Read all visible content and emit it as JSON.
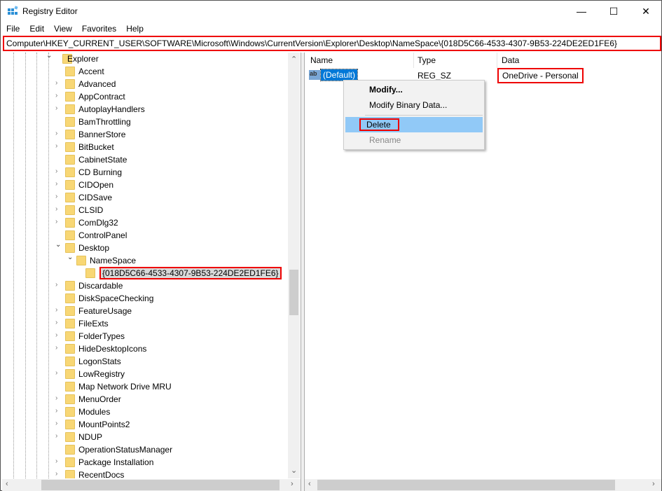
{
  "window": {
    "title": "Registry Editor",
    "controls": {
      "minimize": "—",
      "maximize": "☐",
      "close": "✕"
    }
  },
  "menu": [
    "File",
    "Edit",
    "View",
    "Favorites",
    "Help"
  ],
  "address": "Computer\\HKEY_CURRENT_USER\\SOFTWARE\\Microsoft\\Windows\\CurrentVersion\\Explorer\\Desktop\\NameSpace\\{018D5C66-4533-4307-9B53-224DE2ED1FE6}",
  "tree": [
    {
      "label": "Explorer",
      "level": 0,
      "state": "expanded"
    },
    {
      "label": "Accent",
      "level": 1,
      "state": "leaf"
    },
    {
      "label": "Advanced",
      "level": 1,
      "state": "collapsed"
    },
    {
      "label": "AppContract",
      "level": 1,
      "state": "collapsed"
    },
    {
      "label": "AutoplayHandlers",
      "level": 1,
      "state": "collapsed"
    },
    {
      "label": "BamThrottling",
      "level": 1,
      "state": "leaf"
    },
    {
      "label": "BannerStore",
      "level": 1,
      "state": "collapsed"
    },
    {
      "label": "BitBucket",
      "level": 1,
      "state": "collapsed"
    },
    {
      "label": "CabinetState",
      "level": 1,
      "state": "leaf"
    },
    {
      "label": "CD Burning",
      "level": 1,
      "state": "collapsed"
    },
    {
      "label": "CIDOpen",
      "level": 1,
      "state": "collapsed"
    },
    {
      "label": "CIDSave",
      "level": 1,
      "state": "collapsed"
    },
    {
      "label": "CLSID",
      "level": 1,
      "state": "collapsed"
    },
    {
      "label": "ComDlg32",
      "level": 1,
      "state": "collapsed"
    },
    {
      "label": "ControlPanel",
      "level": 1,
      "state": "leaf"
    },
    {
      "label": "Desktop",
      "level": 1,
      "state": "expanded"
    },
    {
      "label": "NameSpace",
      "level": 2,
      "state": "expanded"
    },
    {
      "label": "{018D5C66-4533-4307-9B53-224DE2ED1FE6}",
      "level": 3,
      "state": "selected"
    },
    {
      "label": "Discardable",
      "level": 1,
      "state": "collapsed"
    },
    {
      "label": "DiskSpaceChecking",
      "level": 1,
      "state": "leaf"
    },
    {
      "label": "FeatureUsage",
      "level": 1,
      "state": "collapsed"
    },
    {
      "label": "FileExts",
      "level": 1,
      "state": "collapsed"
    },
    {
      "label": "FolderTypes",
      "level": 1,
      "state": "collapsed"
    },
    {
      "label": "HideDesktopIcons",
      "level": 1,
      "state": "collapsed"
    },
    {
      "label": "LogonStats",
      "level": 1,
      "state": "leaf"
    },
    {
      "label": "LowRegistry",
      "level": 1,
      "state": "collapsed"
    },
    {
      "label": "Map Network Drive MRU",
      "level": 1,
      "state": "leaf"
    },
    {
      "label": "MenuOrder",
      "level": 1,
      "state": "collapsed"
    },
    {
      "label": "Modules",
      "level": 1,
      "state": "collapsed"
    },
    {
      "label": "MountPoints2",
      "level": 1,
      "state": "collapsed"
    },
    {
      "label": "NDUP",
      "level": 1,
      "state": "collapsed"
    },
    {
      "label": "OperationStatusManager",
      "level": 1,
      "state": "leaf"
    },
    {
      "label": "Package Installation",
      "level": 1,
      "state": "collapsed"
    },
    {
      "label": "RecentDocs",
      "level": 1,
      "state": "collapsed"
    }
  ],
  "list": {
    "headers": {
      "name": "Name",
      "type": "Type",
      "data": "Data"
    },
    "rows": [
      {
        "icon": "ab",
        "name": "(Default)",
        "type": "REG_SZ",
        "data": "OneDrive - Personal"
      }
    ]
  },
  "context_menu": {
    "modify": "Modify...",
    "modify_binary": "Modify Binary Data...",
    "delete": "Delete",
    "rename": "Rename"
  },
  "colors": {
    "highlight": "#e00000",
    "selection": "#0078d7",
    "menu_hover": "#91c9f7"
  }
}
